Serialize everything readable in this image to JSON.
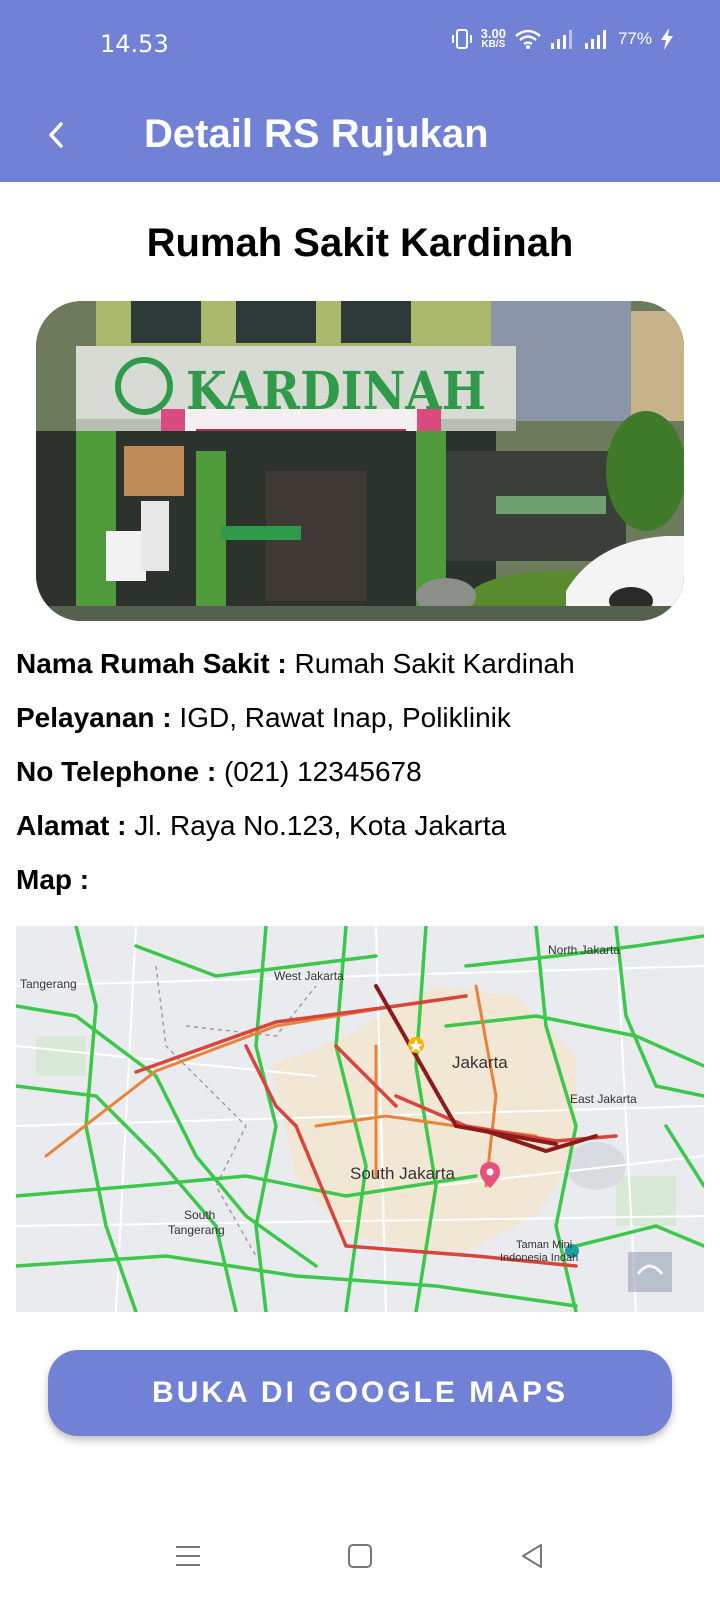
{
  "status_bar": {
    "time": "14.53",
    "speed_value": "3.00",
    "speed_unit": "KB/S",
    "battery": "77%"
  },
  "app_bar": {
    "title": "Detail RS Rujukan",
    "back_icon": "chevron-left-icon"
  },
  "hospital": {
    "title": "Rumah Sakit Kardinah",
    "photo_sign": "KARDINAH",
    "fields": [
      {
        "label": "Nama Rumah Sakit :",
        "value": "Rumah Sakit Kardinah"
      },
      {
        "label": "Pelayanan :",
        "value": "IGD, Rawat Inap, Poliklinik"
      },
      {
        "label": "No Telephone :",
        "value": "(021) 12345678"
      },
      {
        "label": "Alamat :",
        "value": "Jl. Raya No.123, Kota Jakarta"
      },
      {
        "label": "Map :",
        "value": ""
      }
    ]
  },
  "map": {
    "labels": {
      "tangerang": "Tangerang",
      "west_jakarta": "West Jakarta",
      "north_jakarta": "North Jakarta",
      "jakarta": "Jakarta",
      "east_jakarta": "East Jakarta",
      "south_jakarta": "South Jakarta",
      "south_tangerang_1": "South",
      "south_tangerang_2": "Tangerang",
      "taman_mini_1": "Taman Mini",
      "taman_mini_2": "Indonesia Indah"
    }
  },
  "actions": {
    "open_maps": "BUKA DI GOOGLE MAPS"
  },
  "nav": {
    "menu_icon": "menu-icon",
    "home_icon": "home-square-icon",
    "back_icon": "triangle-back-icon"
  },
  "colors": {
    "primary": "#7181d6",
    "map_bg": "#e9ebee",
    "traffic_green": "#3cc84a",
    "traffic_red": "#d9443b",
    "traffic_darkred": "#8b1a1a"
  }
}
